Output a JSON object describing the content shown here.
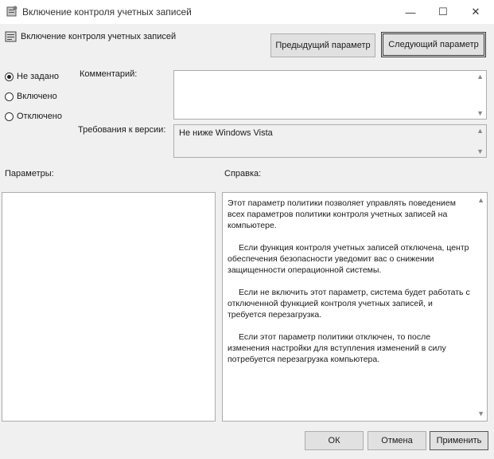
{
  "window": {
    "title": "Включение контроля учетных записей",
    "minimize_glyph": "—",
    "maximize_glyph": "☐",
    "close_glyph": "✕"
  },
  "header": {
    "title": "Включение контроля учетных записей",
    "prev_button": "Предыдущий параметр",
    "next_button": "Следующий параметр"
  },
  "state": {
    "options": [
      {
        "label": "Не задано",
        "checked": true
      },
      {
        "label": "Включено",
        "checked": false
      },
      {
        "label": "Отключено",
        "checked": false
      }
    ]
  },
  "comment": {
    "label": "Комментарий:",
    "value": ""
  },
  "supported": {
    "label": "Требования к версии:",
    "value": "Не ниже Windows Vista"
  },
  "options_label": "Параметры:",
  "help_label": "Справка:",
  "help_text": [
    "Этот параметр политики позволяет управлять поведением всех параметров политики контроля учетных записей на компьютере.",
    "Если функция контроля учетных записей отключена, центр обеспечения безопасности уведомит вас о снижении защищенности операционной системы.",
    "Если не включить этот параметр, система будет работать с отключенной функцией контроля учетных записей, и требуется перезагрузка.",
    "Если этот параметр политики отключен, то после изменения настройки для вступления изменений в силу потребуется перезагрузка компьютера."
  ],
  "footer": {
    "ok": "ОК",
    "cancel": "Отмена",
    "apply": "Применить"
  },
  "icons": {
    "title_icon": "policy-settings-icon",
    "header_icon": "policy-settings-icon"
  },
  "colors": {
    "window_bg": "#f0f0f0",
    "field_border": "#adadad",
    "button_bg": "#e1e1e1"
  }
}
